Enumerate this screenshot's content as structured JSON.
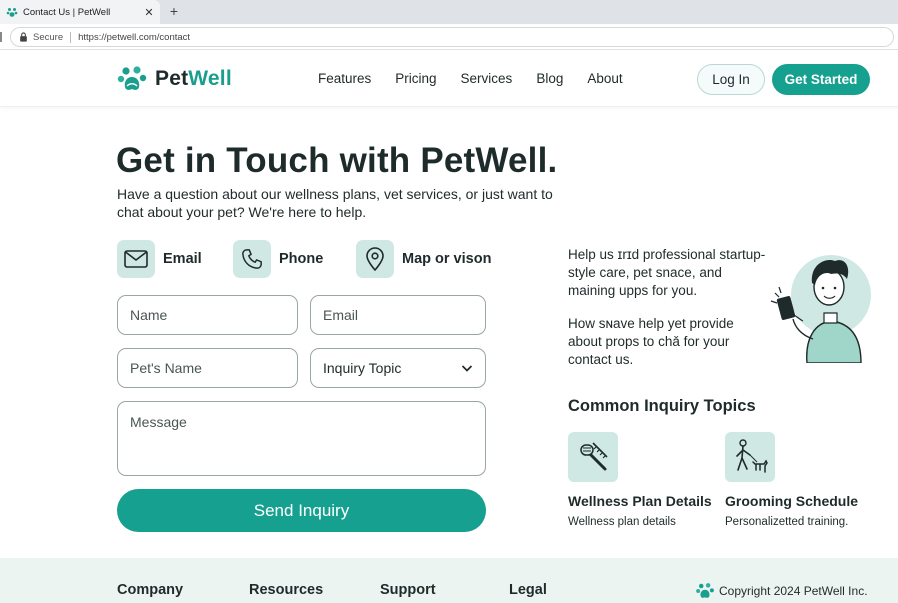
{
  "browser": {
    "tab_title": "Contact Us | PetWell",
    "tab_close": "✕",
    "new_tab": "+",
    "secure_label": "Secure",
    "url": "https://petwell.com/contact"
  },
  "header": {
    "brand_pet": "Pet",
    "brand_well": "Well",
    "nav": [
      "Features",
      "Pricing",
      "Services",
      "Blog",
      "About"
    ],
    "login_label": "Log In",
    "cta_label": "Get Started"
  },
  "hero": {
    "title": "Get in Touch with PetWell.",
    "subtitle": "Have a question about our wellness plans, vet services, or just want to chat about your pet? We're here to help."
  },
  "contact_methods": [
    {
      "label": "Email",
      "icon": "envelope-icon"
    },
    {
      "label": "Phone",
      "icon": "phone-icon"
    },
    {
      "label": "Map or vison",
      "icon": "map-pin-icon"
    }
  ],
  "form": {
    "name_placeholder": "Name",
    "email_placeholder": "Email",
    "pet_name_placeholder": "Pet's Name",
    "inquiry_topic_value": "Inquiry Topic",
    "message_placeholder": "Message",
    "submit_label": "Send Inquiry"
  },
  "side": {
    "help_text_1": "Help us ɪrɪd professional startup-style care, pet snace, and maining upps for you.",
    "help_text_2": "How sɴave help yet provide about props to chǎ for your contact us.",
    "topics_title": "Common Inquiry Topics",
    "topics": [
      {
        "title": "Wellness Plan Details",
        "description": "Wellness plan details",
        "icon": "grooming-brush-icon"
      },
      {
        "title": "Grooming Schedule",
        "description": "Personalizetted training.",
        "icon": "dog-walking-icon"
      }
    ]
  },
  "footer": {
    "columns": [
      "Company",
      "Resources",
      "Support",
      "Legal"
    ],
    "copyright": "Copyright 2024 PetWell Inc."
  },
  "colors": {
    "accent": "#16a08f",
    "icon_bg": "#cfe8e3",
    "footer_bg": "#ecf4f2",
    "text": "#1f2a2a"
  }
}
